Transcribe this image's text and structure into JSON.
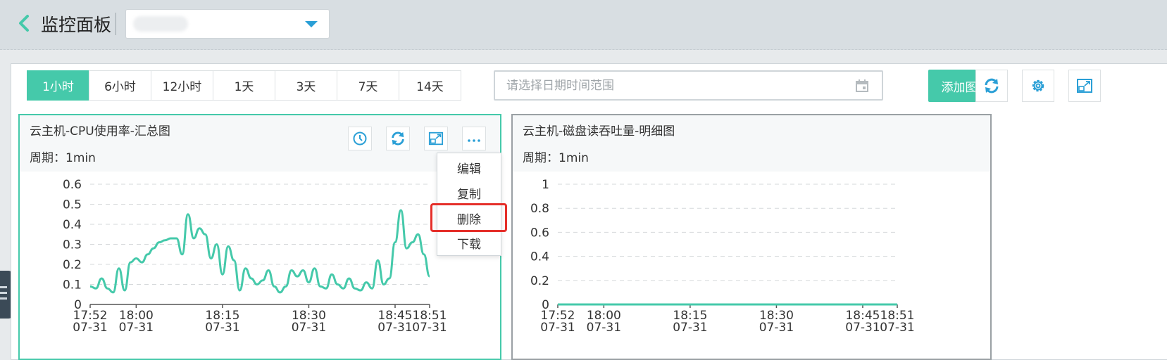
{
  "header": {
    "title": "监控面板"
  },
  "toolbar": {
    "ranges": [
      "1小时",
      "6小时",
      "12小时",
      "1天",
      "3天",
      "7天",
      "14天"
    ],
    "active_range": "1小时",
    "date_placeholder": "请选择日期时间范围",
    "add_chart_label": "添加图表"
  },
  "colors": {
    "accent": "#45c9aa",
    "icon_blue": "#2a9fd6",
    "highlight_red": "#e52f2a"
  },
  "cards": [
    {
      "title": "云主机-CPU使用率-汇总图",
      "period": "周期：1min"
    },
    {
      "title": "云主机-磁盘读吞吐量-明细图",
      "period": "周期：1min"
    }
  ],
  "context_menu": {
    "items": [
      "编辑",
      "复制",
      "删除",
      "下载"
    ],
    "highlighted": "删除"
  },
  "chart_data": [
    {
      "type": "line",
      "title": "云主机-CPU使用率-汇总图",
      "ylim": [
        0,
        0.6
      ],
      "yticks": [
        "0",
        "0.1",
        "0.2",
        "0.3",
        "0.4",
        "0.5",
        "0.6"
      ],
      "xticks": [
        {
          "time": "17:52",
          "date": "07-31"
        },
        {
          "time": "18:00",
          "date": "07-31"
        },
        {
          "time": "18:15",
          "date": "07-31"
        },
        {
          "time": "18:30",
          "date": "07-31"
        },
        {
          "time": "18:45",
          "date": "07-31"
        },
        {
          "time": "18:51",
          "date": "07-31"
        }
      ],
      "xlim": [
        "17:52",
        "18:51"
      ],
      "grid": true,
      "series": [
        {
          "color": "#45c9aa",
          "values": [
            0.09,
            0.08,
            0.13,
            0.08,
            0.06,
            0.18,
            0.07,
            0.21,
            0.23,
            0.21,
            0.25,
            0.28,
            0.31,
            0.32,
            0.33,
            0.33,
            0.25,
            0.45,
            0.33,
            0.38,
            0.35,
            0.23,
            0.3,
            0.15,
            0.29,
            0.22,
            0.07,
            0.18,
            0.13,
            0.1,
            0.12,
            0.17,
            0.09,
            0.06,
            0.09,
            0.17,
            0.14,
            0.17,
            0.11,
            0.18,
            0.09,
            0.08,
            0.15,
            0.1,
            0.08,
            0.13,
            0.08,
            0.07,
            0.11,
            0.08,
            0.22,
            0.1,
            0.13,
            0.31,
            0.47,
            0.28,
            0.31,
            0.35,
            0.25,
            0.14
          ]
        }
      ]
    },
    {
      "type": "line",
      "title": "云主机-磁盘读吞吐量-明细图",
      "ylim": [
        0,
        1
      ],
      "yticks": [
        "0",
        "0.2",
        "0.4",
        "0.6",
        "0.8",
        "1"
      ],
      "xticks": [
        {
          "time": "17:52",
          "date": "07-31"
        },
        {
          "time": "18:00",
          "date": "07-31"
        },
        {
          "time": "18:15",
          "date": "07-31"
        },
        {
          "time": "18:30",
          "date": "07-31"
        },
        {
          "time": "18:45",
          "date": "07-31"
        },
        {
          "time": "18:51",
          "date": "07-31"
        }
      ],
      "xlim": [
        "17:52",
        "18:51"
      ],
      "grid": true,
      "series": [
        {
          "color": "#45c9aa",
          "values": [
            0,
            0,
            0,
            0,
            0,
            0,
            0,
            0,
            0,
            0
          ]
        }
      ]
    }
  ]
}
